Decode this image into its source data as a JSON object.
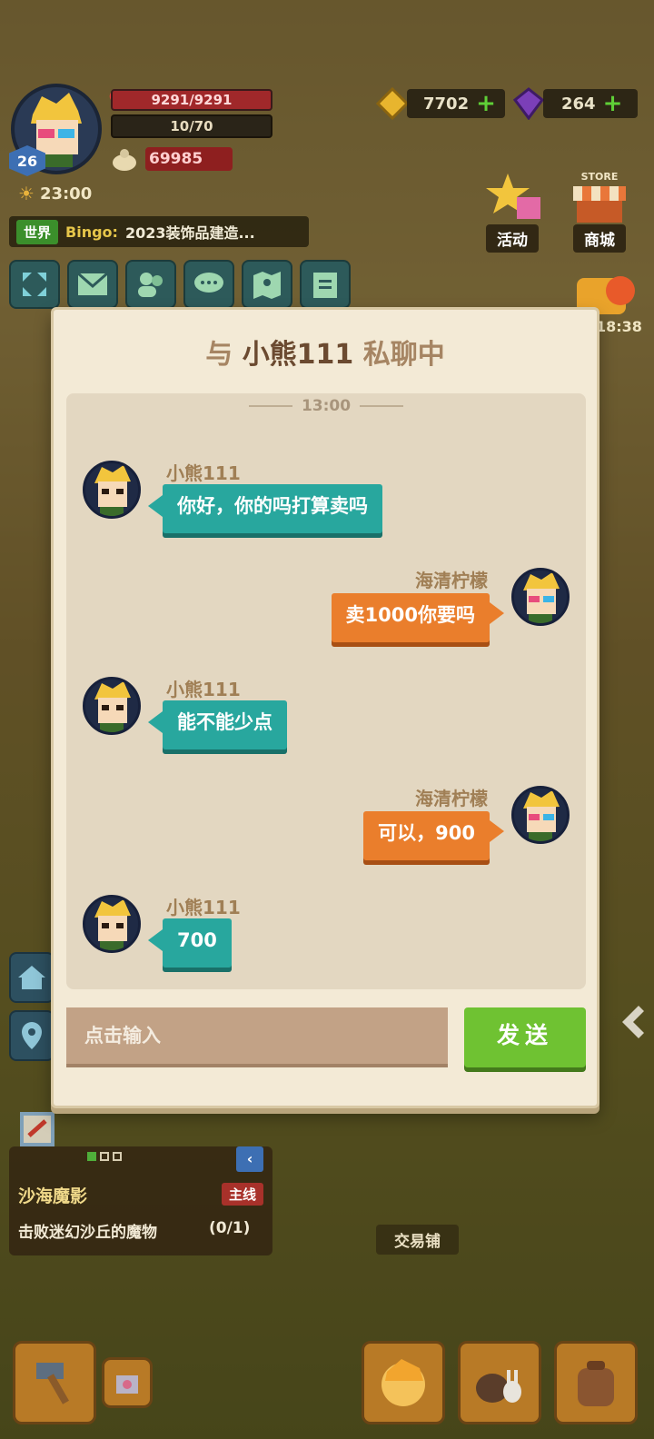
{
  "hud": {
    "level": "26",
    "hp": "9291/9291",
    "energy": "10/70",
    "coins": "69985",
    "clock": "23:00",
    "gold": "7702",
    "gems": "264",
    "world_channel": {
      "tag": "世界",
      "sender": "Bingo:",
      "message": "2023装饰品建造..."
    },
    "menu": {
      "activity_label": "活动",
      "store_label": "商城",
      "store_sign": "STORE",
      "timer": "18:38"
    }
  },
  "chat": {
    "title_prefix": "与",
    "partner": "小熊111",
    "title_suffix": "私聊中",
    "time_separator": "13:00",
    "messages": [
      {
        "side": "left",
        "sender": "小熊111",
        "text": "你好，你的吗打算卖吗"
      },
      {
        "side": "right",
        "sender": "海清柠檬",
        "text": "卖1000你要吗"
      },
      {
        "side": "left",
        "sender": "小熊111",
        "text": "能不能少点"
      },
      {
        "side": "right",
        "sender": "海清柠檬",
        "text": "可以，900"
      },
      {
        "side": "left",
        "sender": "小熊111",
        "text": "700"
      }
    ],
    "input_placeholder": "点击输入",
    "send_label": "发送"
  },
  "quest": {
    "title": "沙海魔影",
    "tag": "主线",
    "description": "击败迷幻沙丘的魔物",
    "progress": "(0/1)"
  },
  "world_labels": {
    "trade_shop": "交易铺"
  },
  "colors": {
    "teal_bubble": "#28a79e",
    "orange_bubble": "#ea7e2c",
    "send_button": "#6fc232",
    "dialog_bg": "#f3ead6"
  }
}
